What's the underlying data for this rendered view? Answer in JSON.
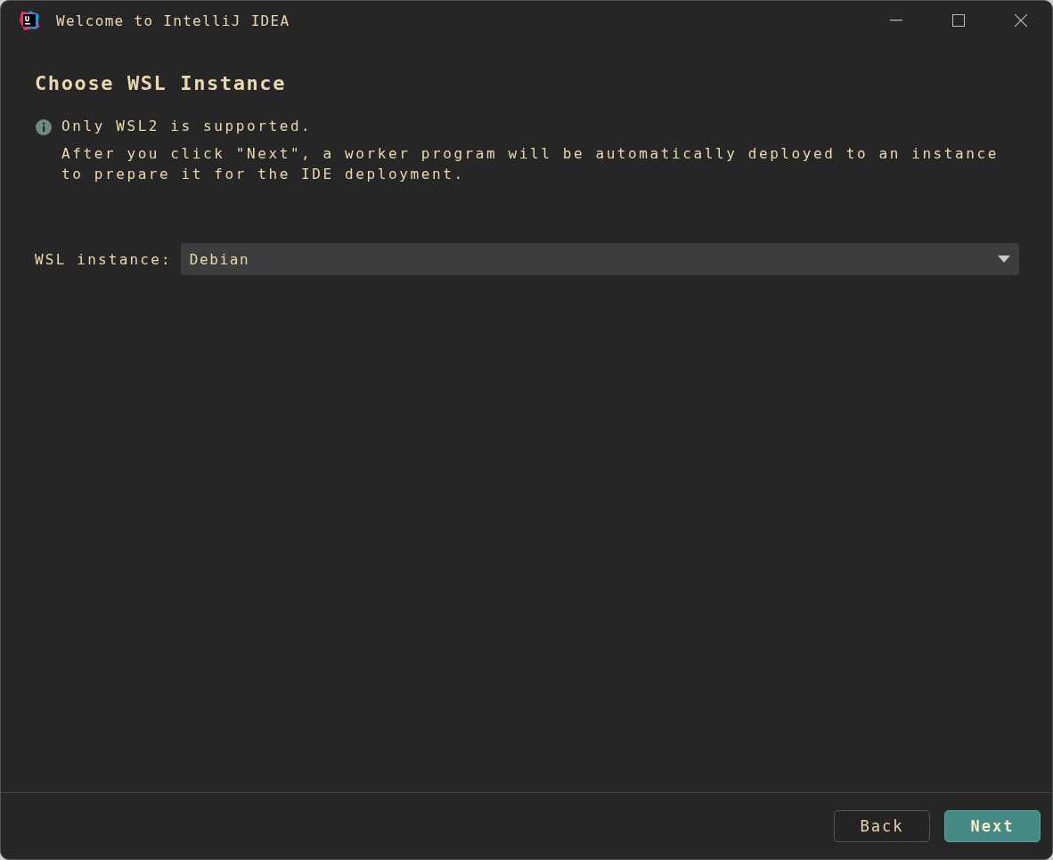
{
  "window": {
    "title": "Welcome to IntelliJ IDEA"
  },
  "heading": "Choose WSL Instance",
  "notice": {
    "title": "Only WSL2 is supported.",
    "lines": [
      "After you click \"Next\", a worker program will be automatically deployed to an instance",
      "to prepare it for the IDE deployment."
    ]
  },
  "instance_field": {
    "label": "WSL instance:",
    "value": "Debian"
  },
  "buttons": [
    {
      "label": "Back",
      "kind": "secondary"
    },
    {
      "label": "Next",
      "kind": "primary"
    }
  ]
}
